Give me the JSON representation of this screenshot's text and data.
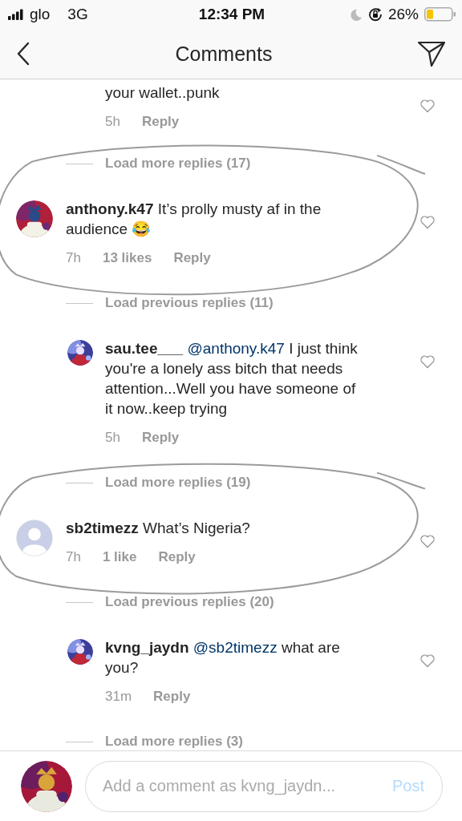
{
  "status_bar": {
    "carrier": "glo",
    "network": "3G",
    "time": "12:34 PM",
    "battery": "26%"
  },
  "header": {
    "title": "Comments"
  },
  "items": [
    {
      "kind": "reply",
      "text": "your wallet..punk",
      "time": "5h",
      "reply_label": "Reply"
    },
    {
      "kind": "load",
      "label": "Load more replies (17)"
    },
    {
      "kind": "comment",
      "circled": true,
      "username": "anthony.k47",
      "text": "It’s prolly musty af in the audience 😂",
      "time": "7h",
      "likes": "13 likes",
      "reply_label": "Reply"
    },
    {
      "kind": "load",
      "label": "Load previous replies (11)"
    },
    {
      "kind": "reply",
      "username": "sau.tee___",
      "mention": "@anthony.k47",
      "text": "I just think you're a lonely ass bitch that needs attention...Well you have someone of it now..keep trying",
      "time": "5h",
      "reply_label": "Reply"
    },
    {
      "kind": "load",
      "label": "Load more replies (19)"
    },
    {
      "kind": "comment",
      "circled": true,
      "avatar": {
        "kind": "default"
      },
      "username": "sb2timezz",
      "text": "What’s Nigeria?",
      "time": "7h",
      "likes": "1 like",
      "reply_label": "Reply"
    },
    {
      "kind": "load",
      "label": "Load previous replies (20)"
    },
    {
      "kind": "reply",
      "username": "kvng_jaydn",
      "mention": "@sb2timezz",
      "text": "what are you?",
      "time": "31m",
      "reply_label": "Reply"
    },
    {
      "kind": "load",
      "label": "Load more replies (3)"
    }
  ],
  "composer": {
    "placeholder": "Add a comment as kvng_jaydn...",
    "post_label": "Post",
    "post_enabled": false
  }
}
